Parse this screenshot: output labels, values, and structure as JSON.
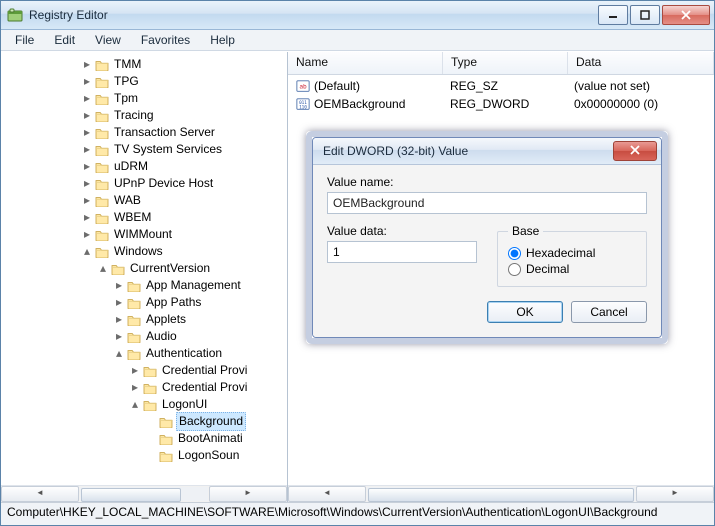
{
  "window": {
    "title": "Registry Editor"
  },
  "menu": {
    "file": "File",
    "edit": "Edit",
    "view": "View",
    "favorites": "Favorites",
    "help": "Help"
  },
  "tree": {
    "items": [
      "TMM",
      "TPG",
      "Tpm",
      "Tracing",
      "Transaction Server",
      "TV System Services",
      "uDRM",
      "UPnP Device Host",
      "WAB",
      "WBEM",
      "WIMMount",
      "Windows"
    ],
    "windows_child": "CurrentVersion",
    "cv_children_top": [
      "App Management",
      "App Paths",
      "Applets",
      "Audio"
    ],
    "auth": "Authentication",
    "auth_children": [
      "Credential Provi",
      "Credential Provi"
    ],
    "logonui": "LogonUI",
    "logonui_children": [
      "Background",
      "BootAnimati",
      "LogonSoun"
    ]
  },
  "listview": {
    "headers": {
      "name": "Name",
      "type": "Type",
      "data": "Data"
    },
    "rows": [
      {
        "name": "(Default)",
        "type": "REG_SZ",
        "data": "(value not set)",
        "icon": "sz"
      },
      {
        "name": "OEMBackground",
        "type": "REG_DWORD",
        "data": "0x00000000 (0)",
        "icon": "dword"
      }
    ]
  },
  "dialog": {
    "title": "Edit DWORD (32-bit) Value",
    "value_name_label": "Value name:",
    "value_name": "OEMBackground",
    "value_data_label": "Value data:",
    "value_data": "1",
    "base_label": "Base",
    "hex_label": "Hexadecimal",
    "dec_label": "Decimal",
    "base_selected": "hex",
    "ok": "OK",
    "cancel": "Cancel"
  },
  "statusbar": {
    "path": "Computer\\HKEY_LOCAL_MACHINE\\SOFTWARE\\Microsoft\\Windows\\CurrentVersion\\Authentication\\LogonUI\\Background"
  },
  "colors": {
    "selection": "#cde8ff"
  }
}
